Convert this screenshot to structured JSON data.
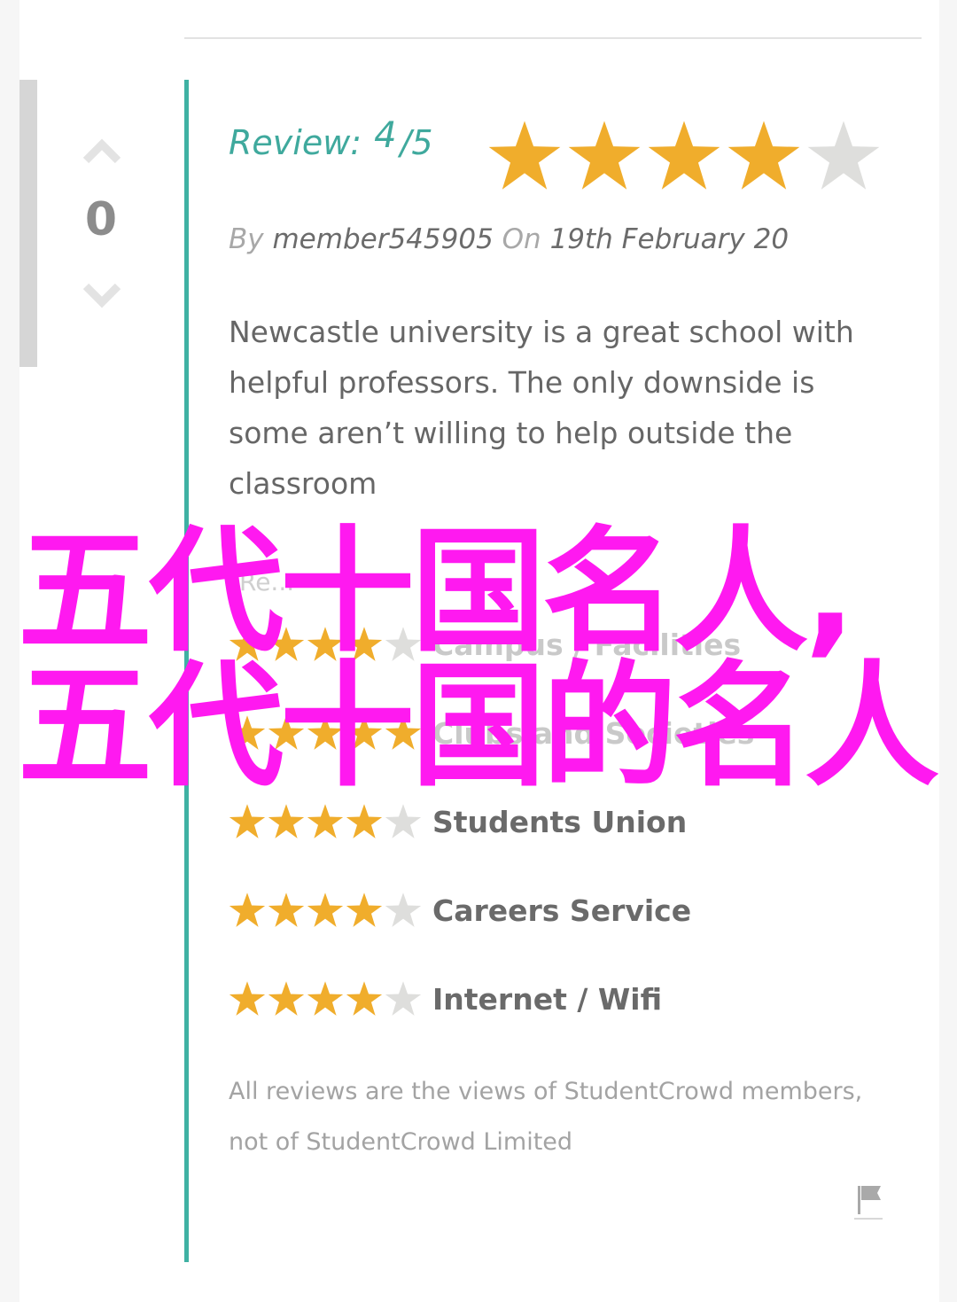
{
  "vote": {
    "count": "0"
  },
  "review": {
    "label": "Review:",
    "score": "4",
    "out_of": "/5",
    "rating": 4,
    "max": 5,
    "by_label": "By",
    "author": "member545905",
    "on_label": "On",
    "date": "19th February 20",
    "text": "Newcastle university is a great school with helpful professors. The only downside is some aren’t willing to help outside the classroom"
  },
  "read_more": "Re...",
  "categories": [
    {
      "label": "Campus / Facilities",
      "rating": 4
    },
    {
      "label": "Clubs and Societies",
      "rating": 5
    },
    {
      "label": "Students Union",
      "rating": 4
    },
    {
      "label": "Careers Service",
      "rating": 4
    },
    {
      "label": "Internet / Wifi",
      "rating": 4
    }
  ],
  "disclaimer": "All reviews are the views of StudentCrowd members, not of StudentCrowd Limited",
  "overlay": {
    "line1": "五代十国名人,",
    "line2": "五代十国的名人"
  },
  "colors": {
    "accent": "#3fb1a3",
    "star_on": "#f0ad2c",
    "star_off": "#dededc",
    "overlay": "#ff19f0"
  },
  "icons": [
    "chevron-up-icon",
    "chevron-down-icon",
    "star-icon",
    "flag-icon"
  ]
}
